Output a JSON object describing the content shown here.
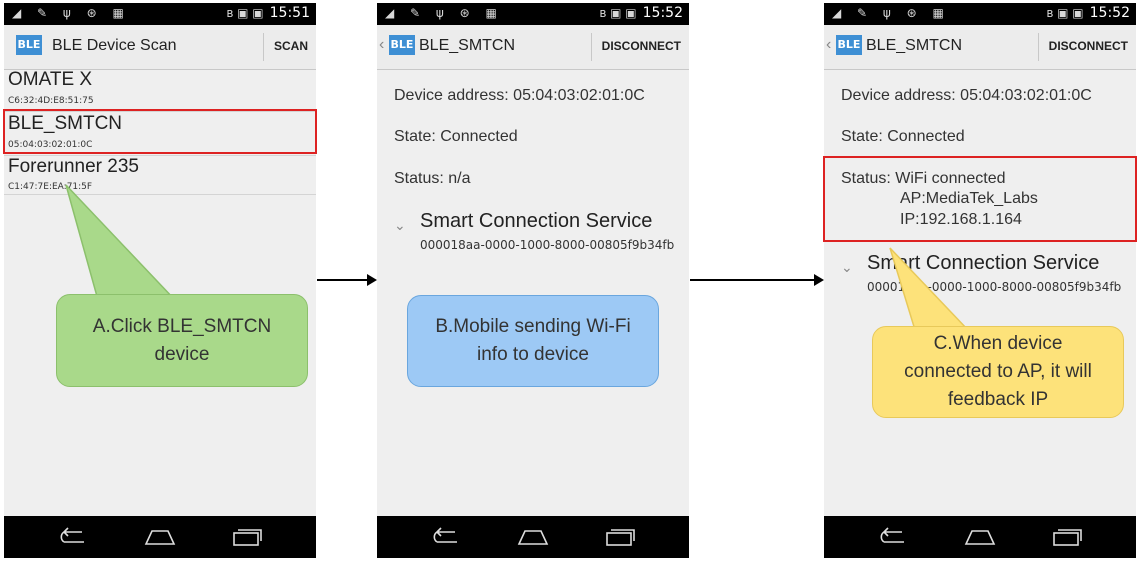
{
  "status_bar": {
    "icons": "◢ ✎ ψ ⊛ ▦",
    "indicators": "ʙ ▣ ▣",
    "screens": [
      "15:51",
      "15:52",
      "15:52"
    ]
  },
  "screen1": {
    "title": "BLE Device Scan",
    "action": "SCAN",
    "devices": [
      {
        "name": "OMATE X",
        "address": "C6:32:4D:E8:51:75"
      },
      {
        "name": "BLE_SMTCN",
        "address": "05:04:03:02:01:0C"
      },
      {
        "name": "Forerunner 235",
        "address": "C1:47:7E:EA:71:5F"
      }
    ]
  },
  "screen2": {
    "title": "BLE_SMTCN",
    "action": "DISCONNECT",
    "device_address": "Device address: 05:04:03:02:01:0C",
    "state": "State: Connected",
    "status": "Status: n/a",
    "service_name": "Smart Connection Service",
    "service_uuid": "000018aa-0000-1000-8000-00805f9b34fb"
  },
  "screen3": {
    "title": "BLE_SMTCN",
    "action": "DISCONNECT",
    "device_address": "Device address: 05:04:03:02:01:0C",
    "state": "State: Connected",
    "status_line1": "Status: WiFi connected",
    "status_line2": "AP:MediaTek_Labs",
    "status_line3": "IP:192.168.1.164",
    "service_name": "Smart Connection Service",
    "service_uuid": "000018aa-0000-1000-8000-00805f9b34fb"
  },
  "logo_text": "BLE",
  "callouts": {
    "a": "A.Click BLE_SMTCN device",
    "b": "B.Mobile sending Wi-Fi info to device",
    "c": "C.When device connected to AP, it will feedback IP"
  },
  "colors": {
    "callout_a": "#a9d98a",
    "callout_b": "#9dc9f5",
    "callout_c": "#fde27a",
    "highlight": "#dd2222"
  }
}
